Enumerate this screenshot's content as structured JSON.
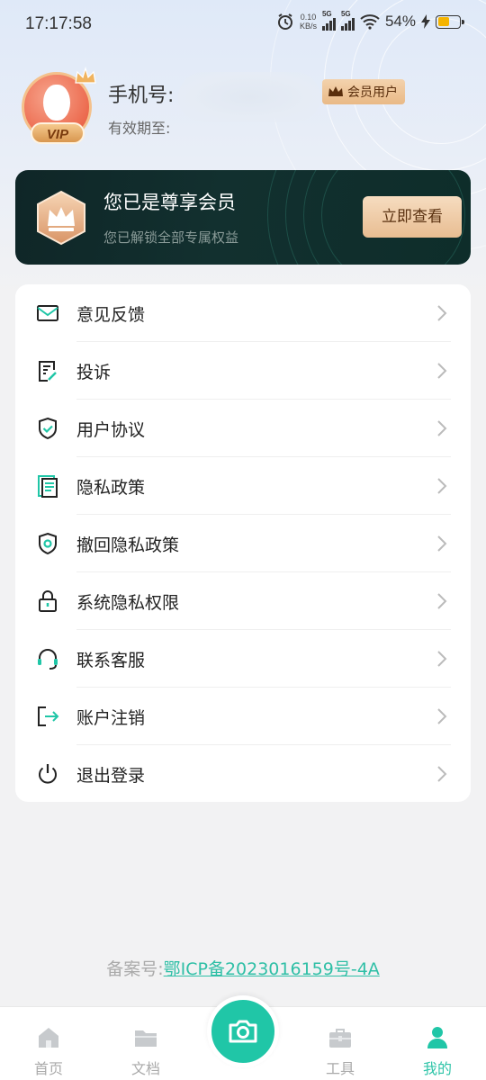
{
  "status_bar": {
    "time": "17:17:58",
    "net_speed_value": "0.10",
    "net_speed_unit": "KB/s",
    "signal1_tag": "5G",
    "signal2_tag": "5G",
    "battery_percent": "54%",
    "battery_level": 0.54,
    "battery_color": "#f5b400"
  },
  "profile": {
    "vip_badge": "VIP",
    "phone_label": "手机号:",
    "expire_label": "有效期至:",
    "member_tag": "会员用户"
  },
  "vip_banner": {
    "title": "您已是尊享会员",
    "subtitle": "您已解锁全部专属权益",
    "button": "立即查看"
  },
  "menu": [
    {
      "label": "意见反馈",
      "icon": "mail-icon"
    },
    {
      "label": "投诉",
      "icon": "complaint-icon"
    },
    {
      "label": "用户协议",
      "icon": "shield-check-icon"
    },
    {
      "label": "隐私政策",
      "icon": "document-icon"
    },
    {
      "label": "撤回隐私政策",
      "icon": "shield-revoke-icon"
    },
    {
      "label": "系统隐私权限",
      "icon": "lock-icon"
    },
    {
      "label": "联系客服",
      "icon": "headset-icon"
    },
    {
      "label": "账户注销",
      "icon": "logout-arrow-icon"
    },
    {
      "label": "退出登录",
      "icon": "power-icon"
    }
  ],
  "footer": {
    "record_label": "备案号:",
    "record_link": "鄂ICP备2023016159号-4A"
  },
  "bottom_nav": {
    "items": [
      {
        "label": "首页",
        "icon": "home-icon"
      },
      {
        "label": "文档",
        "icon": "folder-icon"
      },
      {
        "label": "工具",
        "icon": "toolbox-icon"
      },
      {
        "label": "我的",
        "icon": "user-icon"
      }
    ],
    "active": "我的",
    "center_icon": "camera-icon"
  },
  "colors": {
    "accent": "#20c6a7",
    "vip_banner_bg": "#12302f",
    "gold": "#e9b986"
  }
}
